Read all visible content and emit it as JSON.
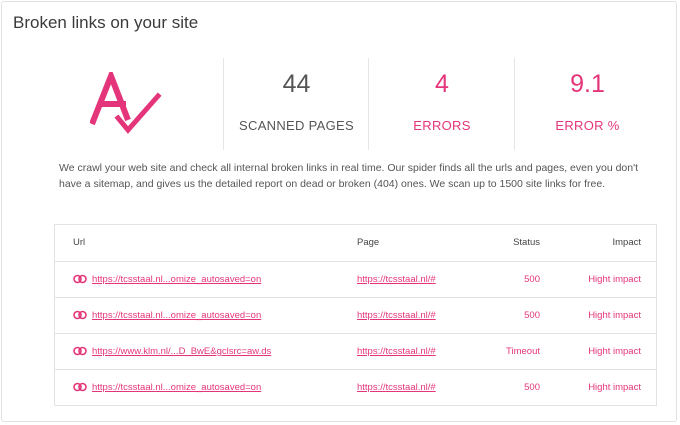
{
  "title": "Broken links on your site",
  "stats": {
    "scanned": {
      "value": "44",
      "label": "SCANNED PAGES"
    },
    "errors": {
      "value": "4",
      "label": "ERRORS"
    },
    "error_pct": {
      "value": "9.1",
      "label": "ERROR %"
    }
  },
  "colors": {
    "accent": "#e5357a",
    "border": "#e3e3e3",
    "text": "#555555"
  },
  "description": "We crawl your web site and check all internal broken links in real time. Our spider finds all the urls and pages, even you don't have a sitemap, and gives us the detailed report on dead or broken (404) ones. We scan up to 1500 site links for free.",
  "table": {
    "headers": {
      "url": "Url",
      "page": "Page",
      "status": "Status",
      "impact": "Impact"
    },
    "rows": [
      {
        "url": "https://tcsstaal.nl...omize_autosaved=on",
        "page": "https://tcsstaal.nl/#",
        "status": "500",
        "impact": "Hight impact"
      },
      {
        "url": "https://tcsstaal.nl...omize_autosaved=on",
        "page": "https://tcsstaal.nl/#",
        "status": "500",
        "impact": "Hight impact"
      },
      {
        "url": "https://www.klm.nl/...D_BwE&gclsrc=aw.ds",
        "page": "https://tcsstaal.nl/#",
        "status": "Timeout",
        "impact": "Hight impact"
      },
      {
        "url": "https://tcsstaal.nl...omize_autosaved=on",
        "page": "https://tcsstaal.nl/#",
        "status": "500",
        "impact": "Hight impact"
      }
    ],
    "row_icon": "link-icon"
  },
  "logo_icon": "a-check-logo"
}
